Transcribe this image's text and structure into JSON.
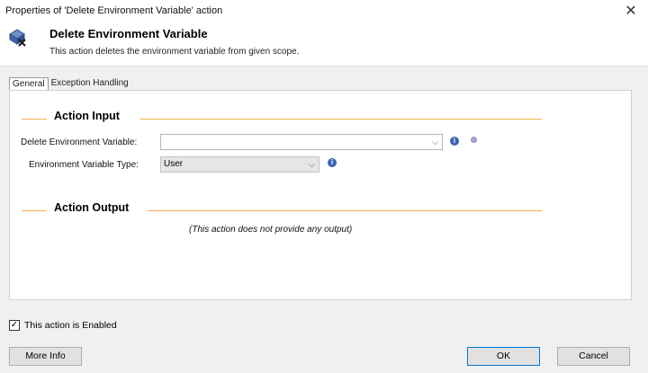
{
  "window": {
    "title": "Properties of 'Delete Environment Variable' action",
    "close_glyph": "✕"
  },
  "header": {
    "title": "Delete Environment Variable",
    "description": "This action deletes the environment variable from given scope.",
    "icon": "delete-env-variable-icon"
  },
  "tabs": [
    {
      "label": "General"
    },
    {
      "label": "Exception Handling"
    }
  ],
  "action_input": {
    "section_title": "Action Input",
    "delete_variable": {
      "label": "Delete Environment Variable:",
      "value": ""
    },
    "variable_type": {
      "label": "Environment Variable Type:",
      "value": "User"
    }
  },
  "action_output": {
    "section_title": "Action Output",
    "note": "(This action does not provide any output)"
  },
  "footer": {
    "enabled_label": "This action is Enabled",
    "enabled_checked": true,
    "more_info": "More Info",
    "ok": "OK",
    "cancel": "Cancel"
  },
  "colors": {
    "section_line": "#f4b04a",
    "info_icon": "#3c64b4",
    "ok_border": "#0078d7"
  }
}
